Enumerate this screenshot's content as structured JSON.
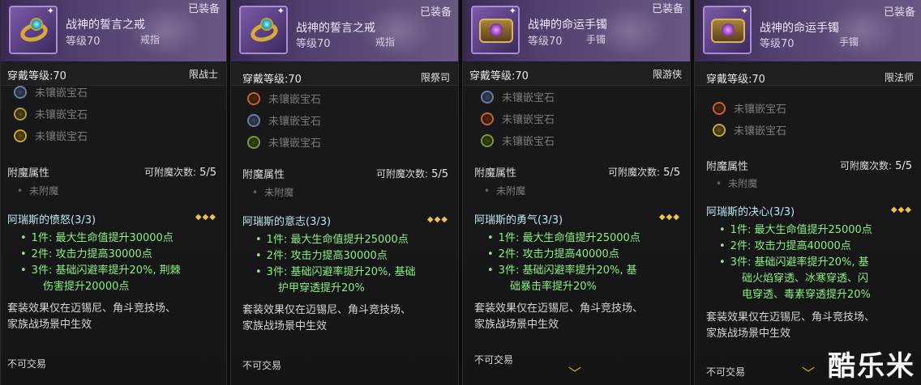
{
  "panels": [
    {
      "item_name": "战神的誓言之戒",
      "level": "等级70",
      "slot": "戒指",
      "equipped": "已装备",
      "wear_level": "穿戴等级:70",
      "class_limit": "限战士",
      "gems": [
        "未镶嵌宝石",
        "未镶嵌宝石",
        "未镶嵌宝石"
      ],
      "gem_colors": [
        "#6a7db0",
        "#b39a3a",
        "#c9a63a"
      ],
      "enchant_title": "附魔属性",
      "enchant_count_label": "可附魔次数:",
      "enchant_count": "5/5",
      "enchant_none": "未附魔",
      "set_title": "阿瑞斯的愤怒(3/3)",
      "set_stars": "◆◆◆",
      "bonus": [
        {
          "lines": [
            "1件: 最大生命值提升30000点"
          ]
        },
        {
          "lines": [
            "2件: 攻击力提高30000点"
          ]
        },
        {
          "lines": [
            "3件: 基础闪避率提升20%, 荆棘",
            "伤害提升20000点"
          ]
        }
      ],
      "note_lines": [
        "套装效果仅在迈锡尼、角斗竞技场、",
        "家族战场景中生效"
      ],
      "trade": "不可交易"
    },
    {
      "item_name": "战神的誓言之戒",
      "level": "等级70",
      "slot": "戒指",
      "equipped": "已装备",
      "wear_level": "穿戴等级:70",
      "class_limit": "限祭司",
      "gems": [
        "未镶嵌宝石",
        "未镶嵌宝石",
        "未镶嵌宝石"
      ],
      "gem_colors": [
        "#c2682a",
        "#6a7db0",
        "#7a9a3a"
      ],
      "enchant_title": "附魔属性",
      "enchant_count_label": "可附魔次数:",
      "enchant_count": "5/5",
      "enchant_none": "未附魔",
      "set_title": "阿瑞斯的意志(3/3)",
      "set_stars": "◆◆◆",
      "bonus": [
        {
          "lines": [
            "1件: 最大生命值提升25000点"
          ]
        },
        {
          "lines": [
            "2件: 攻击力提高30000点"
          ]
        },
        {
          "lines": [
            "3件: 基础闪避率提升20%, 基础",
            "护甲穿透提升20%"
          ]
        }
      ],
      "note_lines": [
        "套装效果仅在迈锡尼、角斗竞技场、",
        "家族战场景中生效"
      ],
      "trade": "不可交易"
    },
    {
      "item_name": "战神的命运手镯",
      "level": "等级70",
      "slot": "手镯",
      "equipped": "已装备",
      "wear_level": "穿戴等级:70",
      "class_limit": "限游侠",
      "gems": [
        "未镶嵌宝石",
        "未镶嵌宝石",
        "未镶嵌宝石"
      ],
      "gem_colors": [
        "#6a7db0",
        "#c2682a",
        "#7a9a3a"
      ],
      "enchant_title": "附魔属性",
      "enchant_count_label": "可附魔次数:",
      "enchant_count": "5/5",
      "enchant_none": "未附魔",
      "set_title": "阿瑞斯的勇气(3/3)",
      "set_stars": "◆◆◆",
      "bonus": [
        {
          "lines": [
            "1件: 最大生命值提升25000点"
          ]
        },
        {
          "lines": [
            "2件: 攻击力提高40000点"
          ]
        },
        {
          "lines": [
            "3件: 基础闪避率提升20%, 基",
            "础暴击率提升20%"
          ]
        }
      ],
      "note_lines": [
        "套装效果仅在迈锡尼、角斗竞技场、",
        "家族战场景中生效"
      ],
      "trade": "不可交易"
    },
    {
      "item_name": "战神的命运手镯",
      "level": "等级70",
      "slot": "手镯",
      "equipped": "已装备",
      "wear_level": "穿戴等级:70",
      "class_limit": "限法师",
      "gems": [
        "未镶嵌宝石",
        "未镶嵌宝石"
      ],
      "gem_colors": [
        "#c2682a",
        "#c9a63a"
      ],
      "enchant_title": "附魔属性",
      "enchant_count_label": "可附魔次数:",
      "enchant_count": "5/5",
      "enchant_none": "未附魔",
      "set_title": "阿瑞斯的决心(3/3)",
      "set_stars": "◆◆◆",
      "bonus": [
        {
          "lines": [
            "1件: 最大生命值提升25000点"
          ]
        },
        {
          "lines": [
            "2件: 攻击力提高40000点"
          ]
        },
        {
          "lines": [
            "3件: 基础闪避率提升20%, 基",
            "础火焰穿透、冰寒穿透、闪",
            "电穿透、毒素穿透提升20%"
          ]
        }
      ],
      "note_lines": [
        "套装效果仅在迈锡尼、角斗竞技场、",
        "家族战场景中生效"
      ],
      "trade": "不可交易"
    }
  ],
  "scroll_indicator": "﹀",
  "watermark": "酷乐米"
}
